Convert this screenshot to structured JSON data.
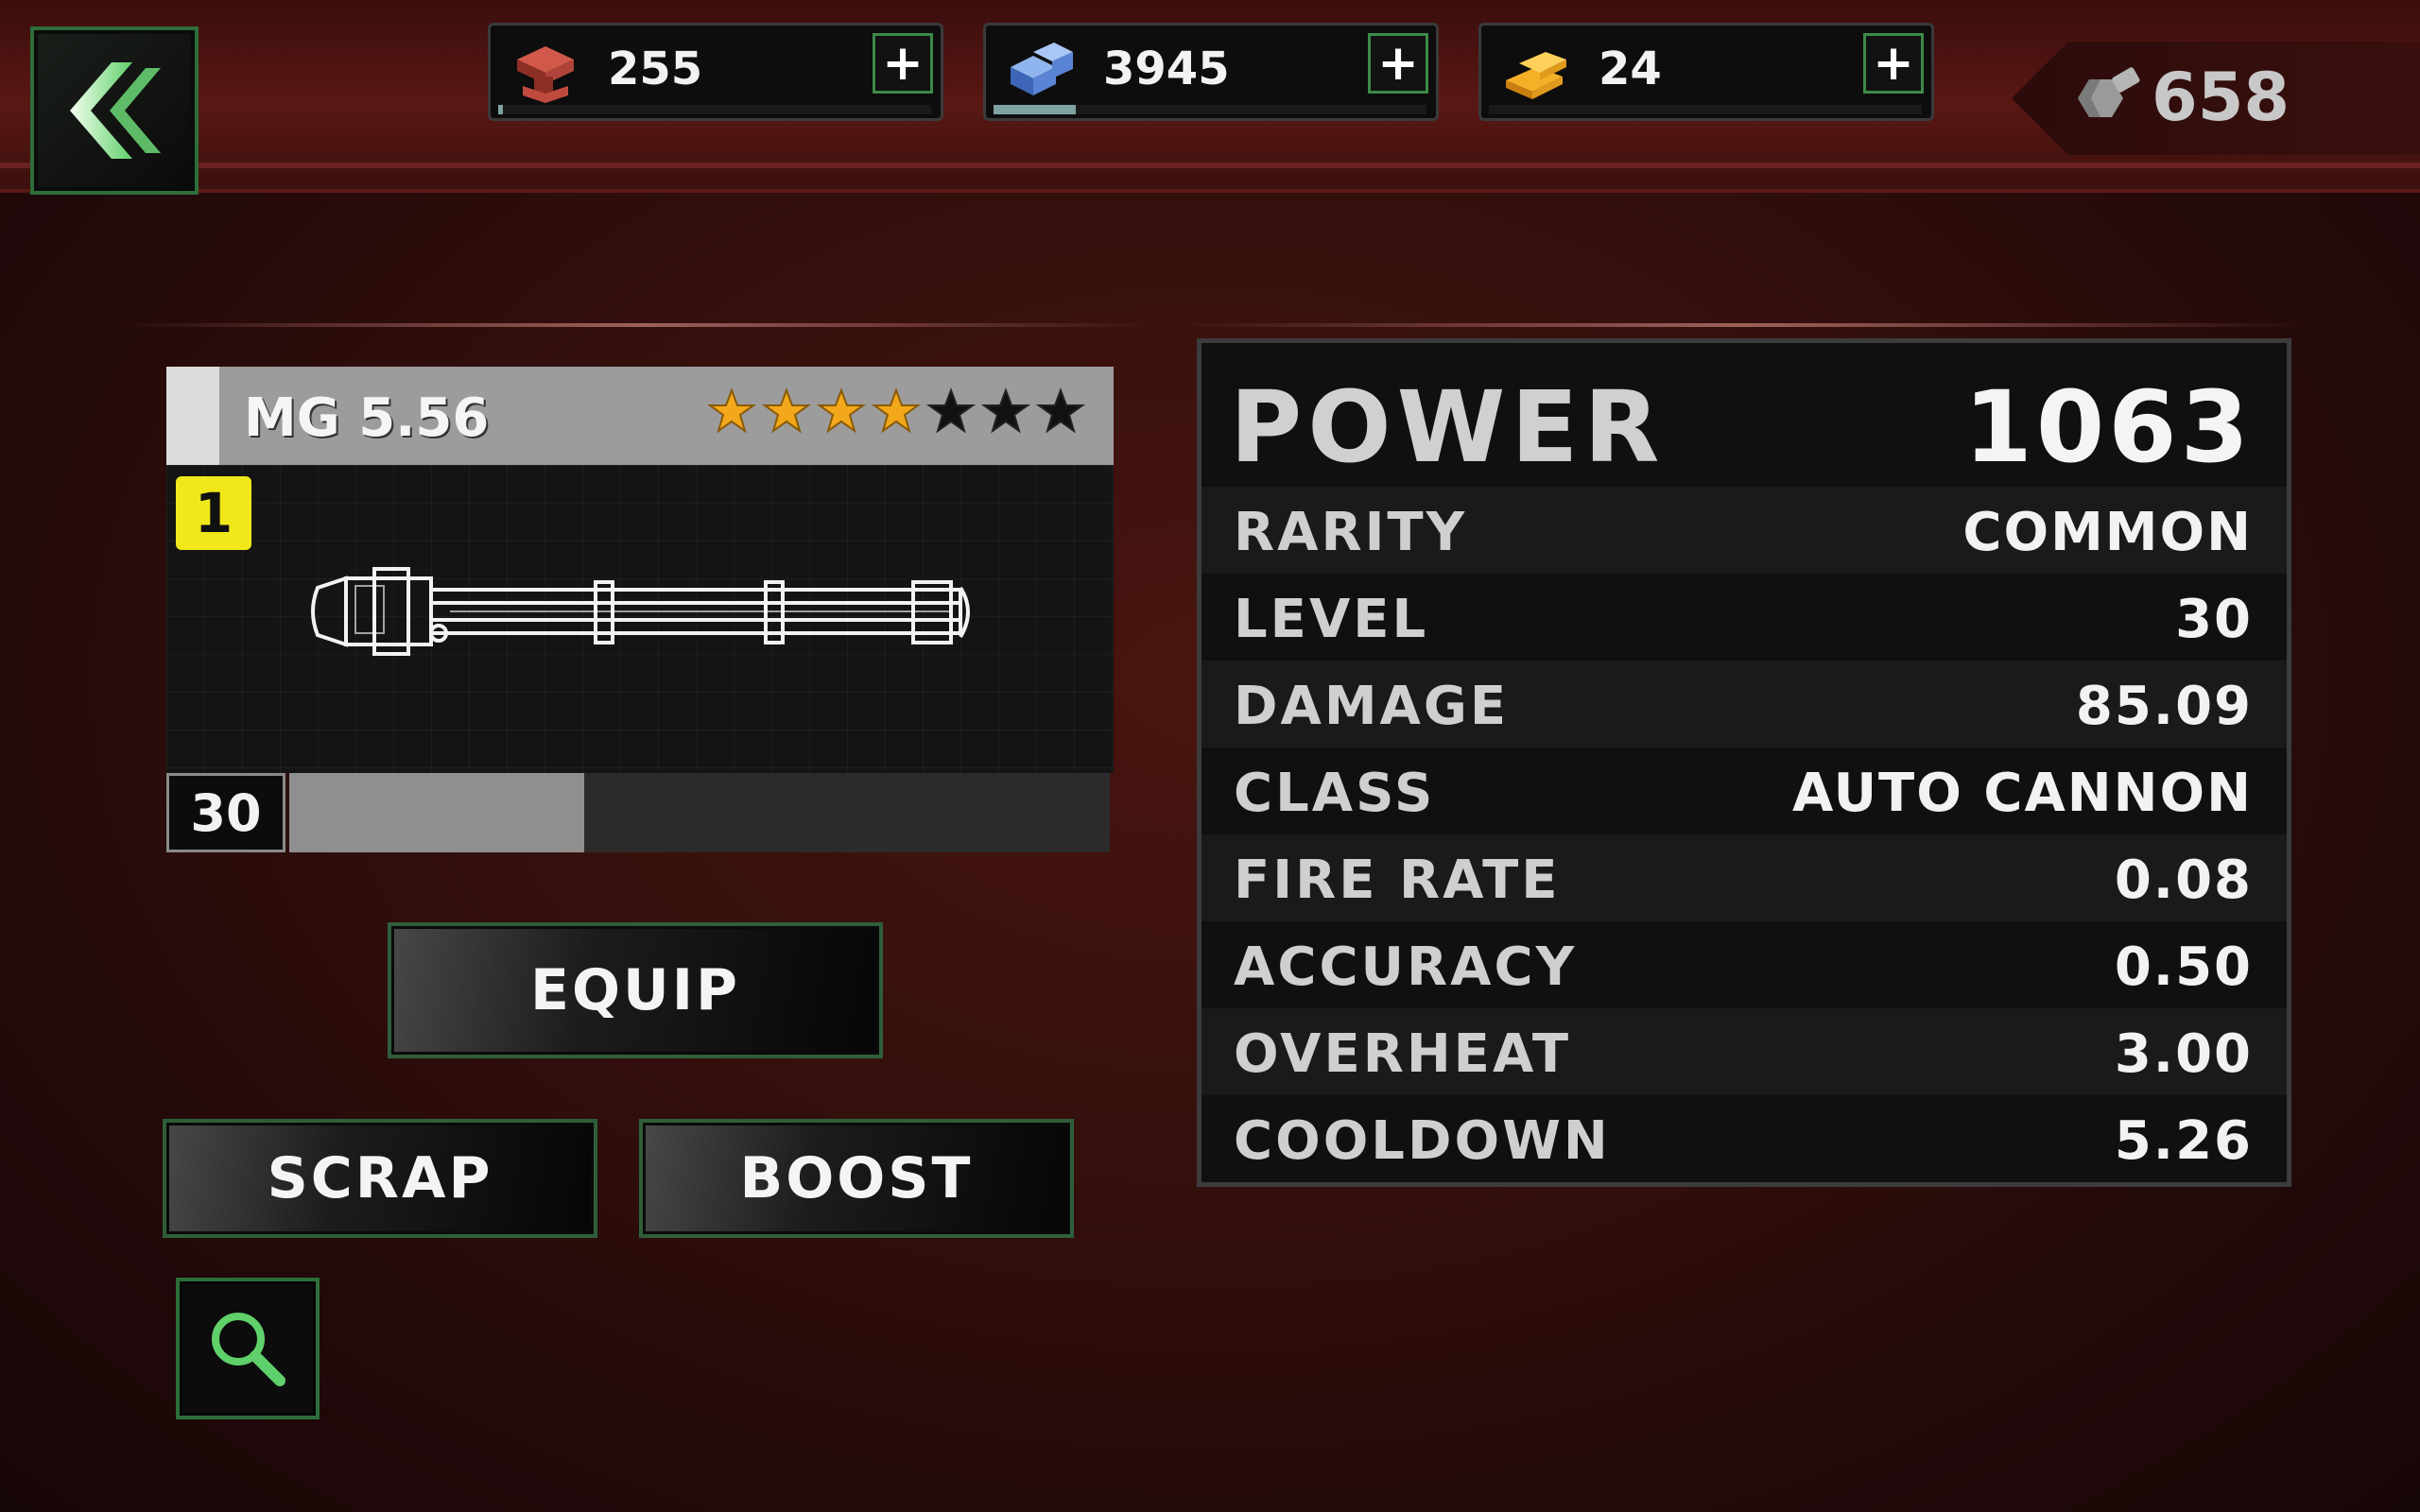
{
  "resources": [
    {
      "icon": "red-parts-icon",
      "value": "255",
      "add_label": "+",
      "fill": 0.01
    },
    {
      "icon": "blue-parts-icon",
      "value": "3945",
      "add_label": "+",
      "fill": 0.19
    },
    {
      "icon": "gold-bars-icon",
      "value": "24",
      "add_label": "+",
      "fill": 0
    }
  ],
  "bolts": {
    "icon": "bolt-icon",
    "value": "658"
  },
  "weapon": {
    "name": "MG 5.56",
    "stars_total": 7,
    "stars_filled": 4,
    "tier": "1",
    "level": "30",
    "xp_progress": 0.36,
    "image": "minigun-blueprint"
  },
  "actions": {
    "equip": "EQUIP",
    "scrap": "SCRAP",
    "boost": "BOOST",
    "inspect_icon": "magnifier-icon",
    "back_icon": "double-chevron-left-icon"
  },
  "stats": {
    "power_label": "POWER",
    "power_value": "1063",
    "rows": [
      {
        "label": "RARITY",
        "value": "COMMON"
      },
      {
        "label": "LEVEL",
        "value": "30"
      },
      {
        "label": "DAMAGE",
        "value": "85.09"
      },
      {
        "label": "CLASS",
        "value": "AUTO CANNON"
      },
      {
        "label": "FIRE RATE",
        "value": "0.08"
      },
      {
        "label": "ACCURACY",
        "value": "0.50"
      },
      {
        "label": "OVERHEAT",
        "value": "3.00"
      },
      {
        "label": "COOLDOWN",
        "value": "5.26"
      }
    ]
  },
  "colors": {
    "accent_green": "#3c8a48",
    "star_gold": "#f2a81a",
    "tier_yellow": "#f0e81a",
    "background_red": "#4a1410"
  }
}
